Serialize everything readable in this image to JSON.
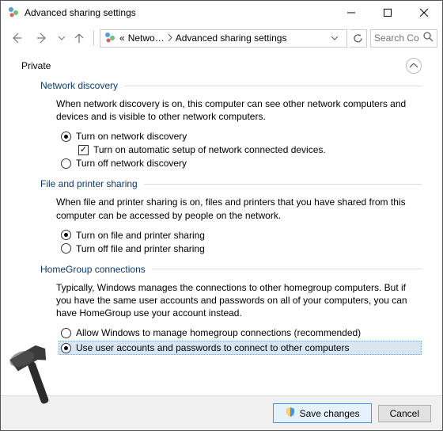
{
  "titlebar": {
    "title": "Advanced sharing settings"
  },
  "nav": {
    "breadcrumb_prefix": "«",
    "breadcrumb1": "Netwo…",
    "breadcrumb2": "Advanced sharing settings",
    "search_placeholder": "Search Co…"
  },
  "content": {
    "profile_label": "Private",
    "network_discovery": {
      "title": "Network discovery",
      "desc": "When network discovery is on, this computer can see other network computers and devices and is visible to other network computers.",
      "opt_on": "Turn on network discovery",
      "opt_auto": "Turn on automatic setup of network connected devices.",
      "opt_off": "Turn off network discovery"
    },
    "file_printer": {
      "title": "File and printer sharing",
      "desc": "When file and printer sharing is on, files and printers that you have shared from this computer can be accessed by people on the network.",
      "opt_on": "Turn on file and printer sharing",
      "opt_off": "Turn off file and printer sharing"
    },
    "homegroup": {
      "title": "HomeGroup connections",
      "desc": "Typically, Windows manages the connections to other homegroup computers. But if you have the same user accounts and passwords on all of your computers, you can have HomeGroup use your account instead.",
      "opt_allow": "Allow Windows to manage homegroup connections (recommended)",
      "opt_user": "Use user accounts and passwords to connect to other computers"
    }
  },
  "footer": {
    "save": "Save changes",
    "cancel": "Cancel"
  }
}
